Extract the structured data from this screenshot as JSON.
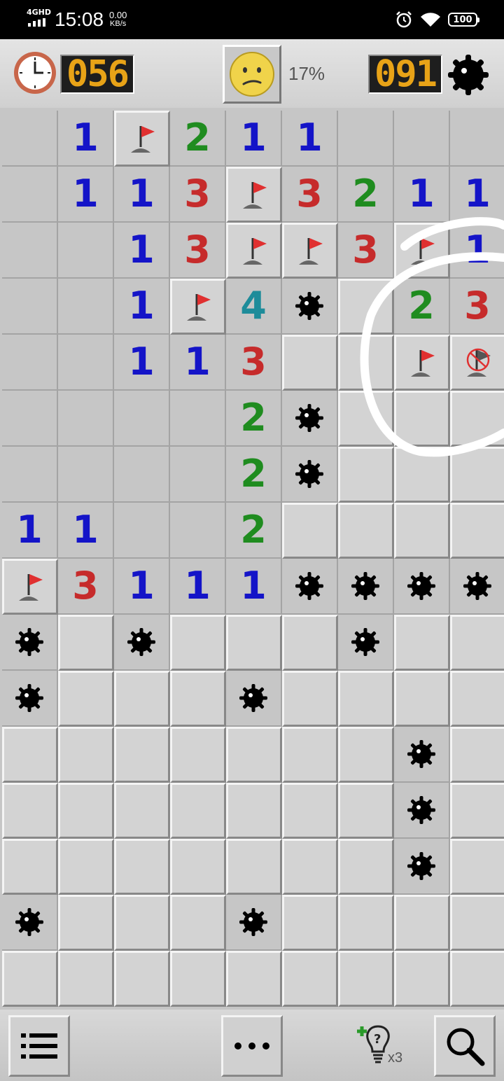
{
  "status_bar": {
    "network": "4GHD",
    "time": "15:08",
    "speed_value": "0.00",
    "speed_unit": "KB/s",
    "battery": "100"
  },
  "header": {
    "timer": "056",
    "progress": "17%",
    "mines_left": "091"
  },
  "footer": {
    "hint_count": "x3"
  },
  "board": {
    "columns": 9,
    "rows": [
      [
        "o",
        "1",
        "F",
        "2",
        "1",
        "1",
        "o",
        "o",
        "o"
      ],
      [
        "o",
        "1",
        "1",
        "3",
        "F",
        "3",
        "2",
        "1",
        "1"
      ],
      [
        "o",
        "o",
        "1",
        "3",
        "F",
        "F",
        "3",
        "F",
        "1"
      ],
      [
        "o",
        "o",
        "1",
        "F",
        "4",
        "M",
        "c",
        "2",
        "3"
      ],
      [
        "o",
        "o",
        "1",
        "1",
        "3",
        "c",
        "c",
        "F",
        "X"
      ],
      [
        "o",
        "o",
        "o",
        "o",
        "2",
        "M",
        "c",
        "c",
        "c"
      ],
      [
        "o",
        "o",
        "o",
        "o",
        "2",
        "M",
        "c",
        "c",
        "c"
      ],
      [
        "1",
        "1",
        "o",
        "o",
        "2",
        "c",
        "c",
        "c",
        "c"
      ],
      [
        "F",
        "3",
        "1",
        "1",
        "1",
        "M",
        "M",
        "M",
        "M"
      ],
      [
        "M",
        "c",
        "M",
        "c",
        "c",
        "c",
        "M",
        "c",
        "c"
      ],
      [
        "M",
        "c",
        "c",
        "c",
        "M",
        "c",
        "c",
        "c",
        "c"
      ],
      [
        "c",
        "c",
        "c",
        "c",
        "c",
        "c",
        "c",
        "M",
        "c"
      ],
      [
        "c",
        "c",
        "c",
        "c",
        "c",
        "c",
        "c",
        "M",
        "c"
      ],
      [
        "c",
        "c",
        "c",
        "c",
        "c",
        "c",
        "c",
        "M",
        "c"
      ],
      [
        "M",
        "c",
        "c",
        "c",
        "M",
        "c",
        "c",
        "c",
        "c"
      ],
      [
        "c",
        "c",
        "c",
        "c",
        "c",
        "c",
        "c",
        "c",
        "c"
      ]
    ],
    "legend": {
      "o": "revealed-empty",
      "c": "covered",
      "F": "flag",
      "M": "mine",
      "X": "wrong-flag"
    }
  }
}
